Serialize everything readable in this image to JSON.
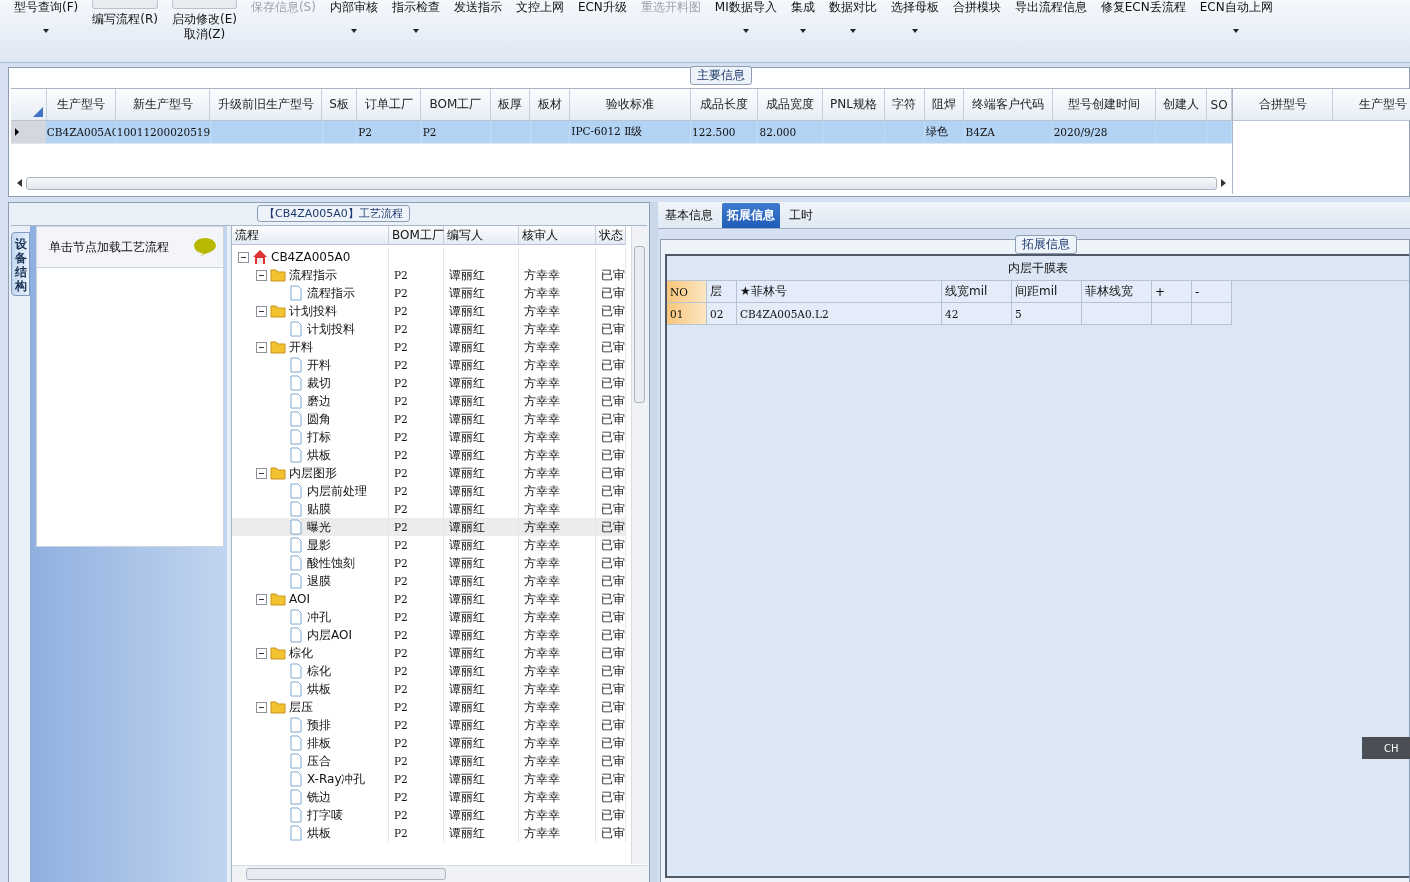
{
  "toolbar": [
    {
      "labels": [
        "型号查询(F)"
      ],
      "kind": "plain",
      "dropdown": true,
      "disabled": false
    },
    {
      "labels": [
        "编写流程(R)"
      ],
      "kind": "stacked",
      "dropdown": false,
      "disabled": false
    },
    {
      "labels": [
        "启动修改(E)",
        "取消(Z)"
      ],
      "kind": "stacked",
      "dropdown": false,
      "disabled": false
    },
    {
      "labels": [
        "保存信息(S)"
      ],
      "kind": "plain",
      "dropdown": false,
      "disabled": true
    },
    {
      "labels": [
        "内部审核"
      ],
      "kind": "plain",
      "dropdown": true,
      "disabled": false
    },
    {
      "labels": [
        "指示检查"
      ],
      "kind": "plain",
      "dropdown": true,
      "disabled": false
    },
    {
      "labels": [
        "发送指示"
      ],
      "kind": "plain",
      "dropdown": false,
      "disabled": false
    },
    {
      "labels": [
        "文控上网"
      ],
      "kind": "plain",
      "dropdown": false,
      "disabled": false
    },
    {
      "labels": [
        "ECN升级"
      ],
      "kind": "plain",
      "dropdown": false,
      "disabled": false
    },
    {
      "labels": [
        "重选开料图"
      ],
      "kind": "plain",
      "dropdown": false,
      "disabled": true
    },
    {
      "labels": [
        "MI数据导入"
      ],
      "kind": "plain",
      "dropdown": true,
      "disabled": false
    },
    {
      "labels": [
        "集成"
      ],
      "kind": "plain",
      "dropdown": true,
      "disabled": false
    },
    {
      "labels": [
        "数据对比"
      ],
      "kind": "plain",
      "dropdown": true,
      "disabled": false
    },
    {
      "labels": [
        "选择母板"
      ],
      "kind": "plain",
      "dropdown": true,
      "disabled": false
    },
    {
      "labels": [
        "合拼模块"
      ],
      "kind": "plain",
      "dropdown": false,
      "disabled": false
    },
    {
      "labels": [
        "导出流程信息"
      ],
      "kind": "plain",
      "dropdown": false,
      "disabled": false
    },
    {
      "labels": [
        "修复ECN丢流程"
      ],
      "kind": "plain",
      "dropdown": false,
      "disabled": false
    },
    {
      "labels": [
        "ECN自动上网"
      ],
      "kind": "plain",
      "dropdown": true,
      "disabled": false
    }
  ],
  "main_info": {
    "title": "主要信息",
    "table": {
      "columns": [
        "生产型号",
        "新生产型号",
        "升级前旧生产型号",
        "S板",
        "订单工厂",
        "BOM工厂",
        "板厚",
        "板材",
        "验收标准",
        "成品长度",
        "成品宽度",
        "PNL规格",
        "字符",
        "阻焊",
        "终端客户代码",
        "型号创建时间",
        "创建人",
        "SO"
      ],
      "rows": [
        {
          "selected": true,
          "cells": [
            "CB4ZA005A0",
            "10011200020519",
            null,
            null,
            "P2",
            "P2",
            null,
            null,
            "IPC-6012 Ⅱ级",
            "122.500",
            "82.000",
            null,
            null,
            "绿色",
            "B4ZA",
            "2020/9/28",
            null,
            null
          ]
        }
      ]
    },
    "merge_table": {
      "columns": [
        "合拼型号",
        "生产型号"
      ]
    }
  },
  "process": {
    "title": "【CB4ZA005A0】工艺流程",
    "side_tab": "设备结构",
    "hint": "单击节点加载工艺流程",
    "tree": {
      "columns": [
        "流程",
        "BOM工厂",
        "编写人",
        "核审人",
        "状态"
      ],
      "nodes": [
        {
          "name": "CB4ZA005A0",
          "kind": "root",
          "expanded": true,
          "selected": false,
          "children": [
            {
              "name": "流程指示",
              "kind": "folder",
              "expanded": true,
              "selected": false,
              "bom": "P2",
              "writer": "谭丽红",
              "reviewer": "方幸幸",
              "status": "已审",
              "children": [
                {
                  "name": "流程指示",
                  "kind": "step",
                  "selected": false,
                  "bom": "P2",
                  "writer": "谭丽红",
                  "reviewer": "方幸幸",
                  "status": "已审"
                }
              ]
            },
            {
              "name": "计划投料",
              "kind": "folder",
              "expanded": true,
              "selected": false,
              "bom": "P2",
              "writer": "谭丽红",
              "reviewer": "方幸幸",
              "status": "已审",
              "children": [
                {
                  "name": "计划投料",
                  "kind": "step",
                  "selected": false,
                  "bom": "P2",
                  "writer": "谭丽红",
                  "reviewer": "方幸幸",
                  "status": "已审"
                }
              ]
            },
            {
              "name": "开料",
              "kind": "folder",
              "expanded": true,
              "selected": false,
              "bom": "P2",
              "writer": "谭丽红",
              "reviewer": "方幸幸",
              "status": "已审",
              "children": [
                {
                  "name": "开料",
                  "kind": "step",
                  "selected": false,
                  "bom": "P2",
                  "writer": "谭丽红",
                  "reviewer": "方幸幸",
                  "status": "已审"
                },
                {
                  "name": "裁切",
                  "kind": "step",
                  "selected": false,
                  "bom": "P2",
                  "writer": "谭丽红",
                  "reviewer": "方幸幸",
                  "status": "已审"
                },
                {
                  "name": "磨边",
                  "kind": "step",
                  "selected": false,
                  "bom": "P2",
                  "writer": "谭丽红",
                  "reviewer": "方幸幸",
                  "status": "已审"
                },
                {
                  "name": "圆角",
                  "kind": "step",
                  "selected": false,
                  "bom": "P2",
                  "writer": "谭丽红",
                  "reviewer": "方幸幸",
                  "status": "已审"
                },
                {
                  "name": "打标",
                  "kind": "step",
                  "selected": false,
                  "bom": "P2",
                  "writer": "谭丽红",
                  "reviewer": "方幸幸",
                  "status": "已审"
                },
                {
                  "name": "烘板",
                  "kind": "step",
                  "selected": false,
                  "bom": "P2",
                  "writer": "谭丽红",
                  "reviewer": "方幸幸",
                  "status": "已审"
                }
              ]
            },
            {
              "name": "内层图形",
              "kind": "folder",
              "expanded": true,
              "selected": false,
              "bom": "P2",
              "writer": "谭丽红",
              "reviewer": "方幸幸",
              "status": "已审",
              "children": [
                {
                  "name": "内层前处理",
                  "kind": "step",
                  "selected": false,
                  "bom": "P2",
                  "writer": "谭丽红",
                  "reviewer": "方幸幸",
                  "status": "已审"
                },
                {
                  "name": "贴膜",
                  "kind": "step",
                  "selected": false,
                  "bom": "P2",
                  "writer": "谭丽红",
                  "reviewer": "方幸幸",
                  "status": "已审"
                },
                {
                  "name": "曝光",
                  "kind": "step",
                  "selected": true,
                  "bom": "P2",
                  "writer": "谭丽红",
                  "reviewer": "方幸幸",
                  "status": "已审"
                },
                {
                  "name": "显影",
                  "kind": "step",
                  "selected": false,
                  "bom": "P2",
                  "writer": "谭丽红",
                  "reviewer": "方幸幸",
                  "status": "已审"
                },
                {
                  "name": "酸性蚀刻",
                  "kind": "step",
                  "selected": false,
                  "bom": "P2",
                  "writer": "谭丽红",
                  "reviewer": "方幸幸",
                  "status": "已审"
                },
                {
                  "name": "退膜",
                  "kind": "step",
                  "selected": false,
                  "bom": "P2",
                  "writer": "谭丽红",
                  "reviewer": "方幸幸",
                  "status": "已审"
                }
              ]
            },
            {
              "name": "AOI",
              "kind": "folder",
              "expanded": true,
              "selected": false,
              "bom": "P2",
              "writer": "谭丽红",
              "reviewer": "方幸幸",
              "status": "已审",
              "children": [
                {
                  "name": "冲孔",
                  "kind": "step",
                  "selected": false,
                  "bom": "P2",
                  "writer": "谭丽红",
                  "reviewer": "方幸幸",
                  "status": "已审"
                },
                {
                  "name": "内层AOI",
                  "kind": "step",
                  "selected": false,
                  "bom": "P2",
                  "writer": "谭丽红",
                  "reviewer": "方幸幸",
                  "status": "已审"
                }
              ]
            },
            {
              "name": "棕化",
              "kind": "folder",
              "expanded": true,
              "selected": false,
              "bom": "P2",
              "writer": "谭丽红",
              "reviewer": "方幸幸",
              "status": "已审",
              "children": [
                {
                  "name": "棕化",
                  "kind": "step",
                  "selected": false,
                  "bom": "P2",
                  "writer": "谭丽红",
                  "reviewer": "方幸幸",
                  "status": "已审"
                },
                {
                  "name": "烘板",
                  "kind": "step",
                  "selected": false,
                  "bom": "P2",
                  "writer": "谭丽红",
                  "reviewer": "方幸幸",
                  "status": "已审"
                }
              ]
            },
            {
              "name": "层压",
              "kind": "folder",
              "expanded": true,
              "selected": false,
              "bom": "P2",
              "writer": "谭丽红",
              "reviewer": "方幸幸",
              "status": "已审",
              "children": [
                {
                  "name": "预排",
                  "kind": "step",
                  "selected": false,
                  "bom": "P2",
                  "writer": "谭丽红",
                  "reviewer": "方幸幸",
                  "status": "已审"
                },
                {
                  "name": "排板",
                  "kind": "step",
                  "selected": false,
                  "bom": "P2",
                  "writer": "谭丽红",
                  "reviewer": "方幸幸",
                  "status": "已审"
                },
                {
                  "name": "压合",
                  "kind": "step",
                  "selected": false,
                  "bom": "P2",
                  "writer": "谭丽红",
                  "reviewer": "方幸幸",
                  "status": "已审"
                },
                {
                  "name": "X-Ray冲孔",
                  "kind": "step",
                  "selected": false,
                  "bom": "P2",
                  "writer": "谭丽红",
                  "reviewer": "方幸幸",
                  "status": "已审"
                },
                {
                  "name": "铣边",
                  "kind": "step",
                  "selected": false,
                  "bom": "P2",
                  "writer": "谭丽红",
                  "reviewer": "方幸幸",
                  "status": "已审"
                },
                {
                  "name": "打字唛",
                  "kind": "step",
                  "selected": false,
                  "bom": "P2",
                  "writer": "谭丽红",
                  "reviewer": "方幸幸",
                  "status": "已审"
                },
                {
                  "name": "烘板",
                  "kind": "step",
                  "selected": false,
                  "bom": "P2",
                  "writer": "谭丽红",
                  "reviewer": "方幸幸",
                  "status": "已审"
                }
              ]
            }
          ]
        }
      ]
    }
  },
  "detail": {
    "tabs": [
      {
        "label": "基本信息",
        "selected": false
      },
      {
        "label": "拓展信息",
        "selected": true
      },
      {
        "label": "工时",
        "selected": false
      }
    ],
    "group_title": "拓展信息",
    "table": {
      "title": "内层干膜表",
      "columns": [
        "NO",
        "层",
        "★菲林号",
        "线宽mil",
        "间距mil",
        "菲林线宽",
        "+",
        "-"
      ],
      "rows": [
        {
          "cells": [
            "01",
            "02",
            "CB4ZA005A0.L2",
            "42",
            "5",
            null,
            null,
            null
          ]
        }
      ]
    }
  },
  "ime_bar": {
    "label": "CH"
  }
}
